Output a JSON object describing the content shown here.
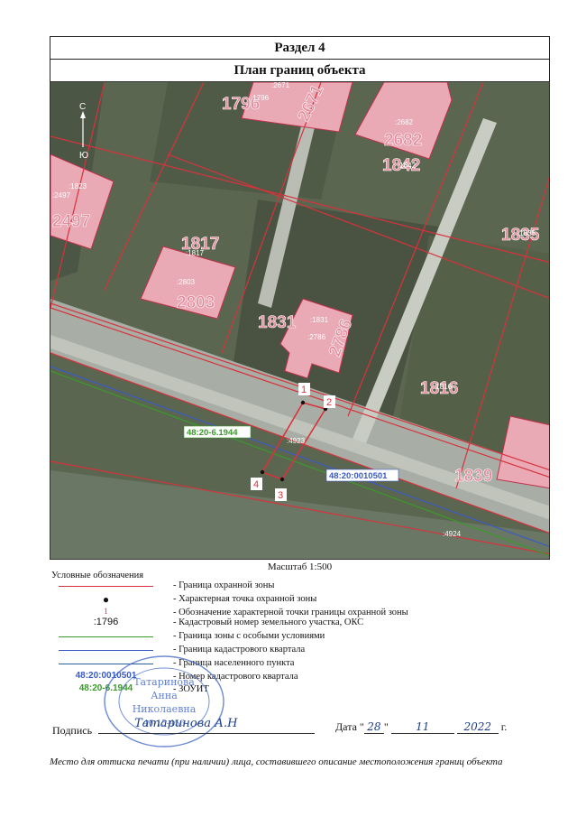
{
  "header": {
    "section": "Раздел 4",
    "title": "План границ объекта"
  },
  "map": {
    "compass": {
      "north": "С",
      "south": "Ю"
    },
    "parcel_big_labels": [
      "1796",
      "2671",
      "2682",
      "1842",
      "2497",
      "1817",
      "2803",
      "1831",
      "2786",
      "1835",
      "1816",
      "1839"
    ],
    "cadastral_labels": [
      ":2671",
      ":1796",
      ":2682",
      ":1842",
      ":1823",
      ":2497",
      ":1817",
      ":2803",
      ":1831",
      ":2786",
      ":1835",
      ":1816",
      ":4923",
      ":4924"
    ],
    "points": [
      "1",
      "2",
      "3",
      "4"
    ],
    "zone_label": "48:20-6.1944",
    "quarter_label": "48:20:0010501",
    "colors": {
      "zone": "#3a9a2a",
      "quarter": "#3a5bc4",
      "boundary": "#d8323c"
    }
  },
  "scale": "Масштаб 1:500",
  "legend": {
    "title": "Условные обозначения",
    "items": [
      {
        "symbol": "",
        "text": "- Граница охранной зоны"
      },
      {
        "symbol": "●",
        "text": "- Характерная точка охранной зоны"
      },
      {
        "symbol": "1",
        "text": "- Обозначение характерной точки границы охранной зоны"
      },
      {
        "symbol": ":1796",
        "text": "- Кадастровый номер земельного участка, ОКС"
      },
      {
        "symbol": "",
        "text": "- Граница зоны с особыми условиями"
      },
      {
        "symbol": "",
        "text": "- Граница кадастрового квартала"
      },
      {
        "symbol": "",
        "text": "- Граница населенного пункта"
      },
      {
        "symbol": "48:20:0010501",
        "text": "- Номер кадастрового квартала"
      },
      {
        "symbol": "48:20-6.1944",
        "text": "- ЗОУИТ"
      }
    ]
  },
  "signature": {
    "label": "Подпись",
    "handwritten": "Татаринова А.Н",
    "date_label": "Дата",
    "day": "28",
    "month": "11",
    "year": "2022",
    "year_suffix": "г."
  },
  "stamp": {
    "lines": [
      "Татаринова",
      "Анна",
      "Николаевна",
      "46-15-456"
    ]
  },
  "footer": "Место для оттиска печати (при наличии) лица, составившего описание местоположения границ объекта"
}
